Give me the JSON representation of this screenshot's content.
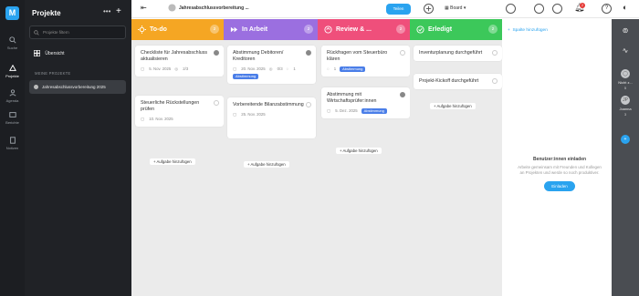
{
  "rail": {
    "logo": "M",
    "items": [
      {
        "label": "Suche"
      },
      {
        "label": "Projekte"
      },
      {
        "label": "Agenda"
      },
      {
        "label": "Berichte"
      },
      {
        "label": "Notizen"
      }
    ]
  },
  "sidebar": {
    "title": "Projekte",
    "search_placeholder": "Projekte filtern",
    "overview": "Übersicht",
    "section_label": "MEINE PROJEKTE",
    "project": "Jahresabschlussvorbereitung 2025"
  },
  "topbar": {
    "project_title": "Jahresabschlussvorbereitung ...",
    "view": "Board",
    "share": "Teilen",
    "notification_count": "2"
  },
  "columns": [
    {
      "title": "To-do",
      "count": "2",
      "color": "#f5a623",
      "cards": [
        {
          "title": "Checkliste für Jahresabschluss aktualisieren",
          "date": "5. Nov. 2025",
          "subtasks": "2/3",
          "done": true
        },
        {
          "title": "Steuerliche Rückstellungen prüfen",
          "date": "10. Nov. 2025",
          "done": false
        }
      ],
      "add": "Aufgabe hinzufügen"
    },
    {
      "title": "In Arbeit",
      "count": "2",
      "color": "#9b6fe0",
      "cards": [
        {
          "title": "Abstimmung Debitoren/ Kreditoren",
          "date": "20. Nov. 2025",
          "subtasks": "0/3",
          "comments": "1",
          "tag": "Abstimmung",
          "done": true
        },
        {
          "title": "Vorbereitende Bilanzabstimmung",
          "date": "25. Nov. 2025",
          "done": false
        }
      ],
      "add": "Aufgabe hinzufügen"
    },
    {
      "title": "Review & ...",
      "count": "2",
      "color": "#ef4f7b",
      "cards": [
        {
          "title": "Rückfragen vom Steuerbüro klären",
          "comments": "1",
          "tag": "Abstimmung",
          "done": false
        },
        {
          "title": "Abstimmung mit Wirtschaftsprüfer:innen",
          "date": "5. Dez. 2025",
          "tag": "Abstimmung",
          "done": true
        }
      ],
      "add": "Aufgabe hinzufügen"
    },
    {
      "title": "Erledigt",
      "count": "2",
      "color": "#3cc85a",
      "cards": [
        {
          "title": "Inventurplanung durchgeführt",
          "done": false
        },
        {
          "title": "Projekt-Kickoff durchgeführt",
          "done": false
        }
      ],
      "add": "Aufgabe hinzufügen"
    }
  ],
  "add_column": "Spalte hinzufügen",
  "invite": {
    "title": "Benutzer:innen einladen",
    "text": "Arbeite gemeinsam mit Freunden und Kollegen an Projekten und werde so noch produktiver.",
    "button": "Einladen"
  },
  "members": {
    "unassigned": "Nicht z...",
    "unassigned_count": "5",
    "user_initial": "JP",
    "user_name": "Joanna",
    "user_count": "3"
  }
}
